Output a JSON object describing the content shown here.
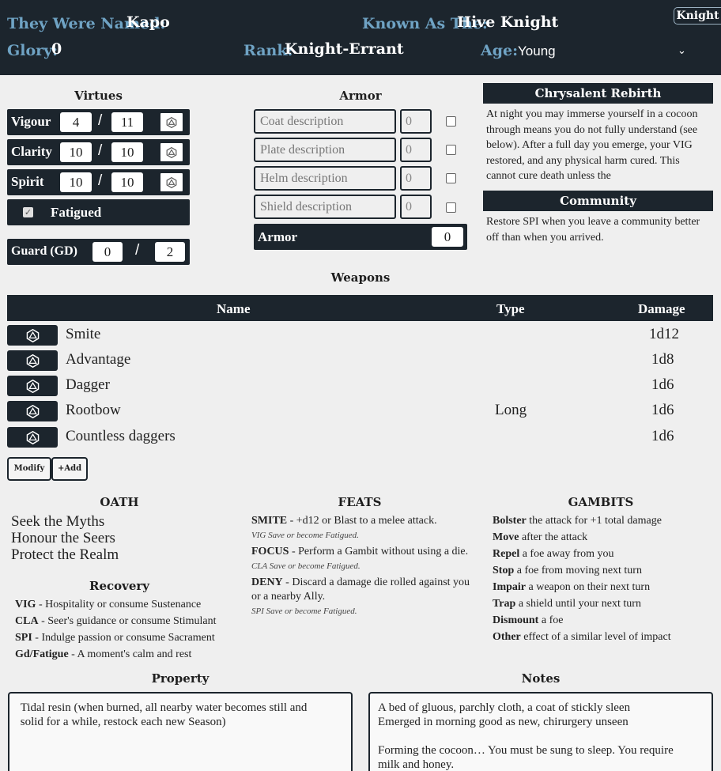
{
  "header": {
    "named_label": "They Were Named:",
    "named_value": "Kapo",
    "known_label": "Known As The:",
    "known_value": "Hive Knight",
    "tag": "Knight",
    "glory_label": "Glory:",
    "glory_value": "0",
    "rank_label": "Rank:",
    "rank_value": "Knight-Errant",
    "age_label": "Age:",
    "age_value": "Young"
  },
  "virtues": {
    "title": "Virtues",
    "items": [
      {
        "name": "Vigour",
        "current": "4",
        "max": "11"
      },
      {
        "name": "Clarity",
        "current": "10",
        "max": "10"
      },
      {
        "name": "Spirit",
        "current": "10",
        "max": "10"
      }
    ],
    "slash": "/",
    "fatigued_label": "Fatigued",
    "fatigued_checked": true,
    "guard": {
      "name": "Guard (GD)",
      "current": "0",
      "max": "2"
    }
  },
  "armor": {
    "title": "Armor",
    "items": [
      {
        "placeholder": "Coat description",
        "value": "0"
      },
      {
        "placeholder": "Plate description",
        "value": "0"
      },
      {
        "placeholder": "Helm description",
        "value": "0"
      },
      {
        "placeholder": "Shield description",
        "value": "0"
      }
    ],
    "total_label": "Armor",
    "total_value": "0"
  },
  "panels": {
    "rebirth_title": "Chrysalent Rebirth",
    "rebirth_text": "At night you may immerse yourself in a cocoon through means you do not fully understand (see below). After a full day you emerge, your VIG restored, and any physical harm cured. This cannot cure death unless the",
    "community_title": "Community",
    "community_text": "Restore SPI when you leave a community better off than when you arrived."
  },
  "weapons": {
    "title": "Weapons",
    "headers": {
      "name": "Name",
      "type": "Type",
      "damage": "Damage"
    },
    "rows": [
      {
        "name": "Smite",
        "type": "",
        "damage": "1d12"
      },
      {
        "name": "Advantage",
        "type": "",
        "damage": "1d8"
      },
      {
        "name": "Dagger",
        "type": "",
        "damage": "1d6"
      },
      {
        "name": "Rootbow",
        "type": "Long",
        "damage": "1d6"
      },
      {
        "name": "Countless daggers",
        "type": "",
        "damage": "1d6"
      }
    ],
    "modify_label": "Modify",
    "add_label": "+Add"
  },
  "oath": {
    "title": "OATH",
    "lines": [
      "Seek the Myths",
      "Honour the Seers",
      "Protect the Realm"
    ]
  },
  "recovery": {
    "title": "Recovery",
    "lines": [
      {
        "key": "VIG",
        "text": " - Hospitality or consume Sustenance"
      },
      {
        "key": "CLA",
        "text": " - Seer's guidance or consume Stimulant"
      },
      {
        "key": "SPI",
        "text": " - Indulge passion or consume Sacrament"
      },
      {
        "key": "Gd/Fatigue",
        "text": " - A moment's calm and rest"
      }
    ]
  },
  "feats": {
    "title": "FEATS",
    "items": [
      {
        "key": "SMITE",
        "text": " - +d12 or Blast to a melee attack.",
        "text2": "",
        "save": "VIG Save or become Fatigued."
      },
      {
        "key": "FOCUS",
        "text": " - Perform a Gambit without using a die.",
        "text2": "",
        "save": "CLA Save or become Fatigued."
      },
      {
        "key": "DENY",
        "text": " - Discard a damage die rolled against you",
        "text2": "or a nearby Ally.",
        "save": "SPI Save or become Fatigued."
      }
    ]
  },
  "gambits": {
    "title": "GAMBITS",
    "items": [
      {
        "key": "Bolster",
        "text": " the attack for +1 total damage"
      },
      {
        "key": "Move",
        "text": " after the attack"
      },
      {
        "key": "Repel",
        "text": " a foe away from you"
      },
      {
        "key": "Stop",
        "text": " a foe from moving next turn"
      },
      {
        "key": "Impair",
        "text": " a weapon on their next turn"
      },
      {
        "key": "Trap",
        "text": " a shield until your next turn"
      },
      {
        "key": "Dismount",
        "text": " a foe"
      },
      {
        "key": "Other",
        "text": " effect of a similar level of impact"
      }
    ]
  },
  "property": {
    "title": "Property",
    "text": " Tidal resin (when burned, all nearby water becomes still and\n solid for a while, restock each new Season)"
  },
  "notes": {
    "title": "Notes",
    "text": "A bed of gluous, parchly cloth, a coat of stickly sleen\nEmerged in morning good as new, chirurgery unseen\n\nForming the cocoon… You must be sung to sleep. You require\nmilk and honey."
  },
  "colors": {
    "dark": "#1c252d",
    "label_blue": "#6fa3c4",
    "background": "#efefef"
  }
}
